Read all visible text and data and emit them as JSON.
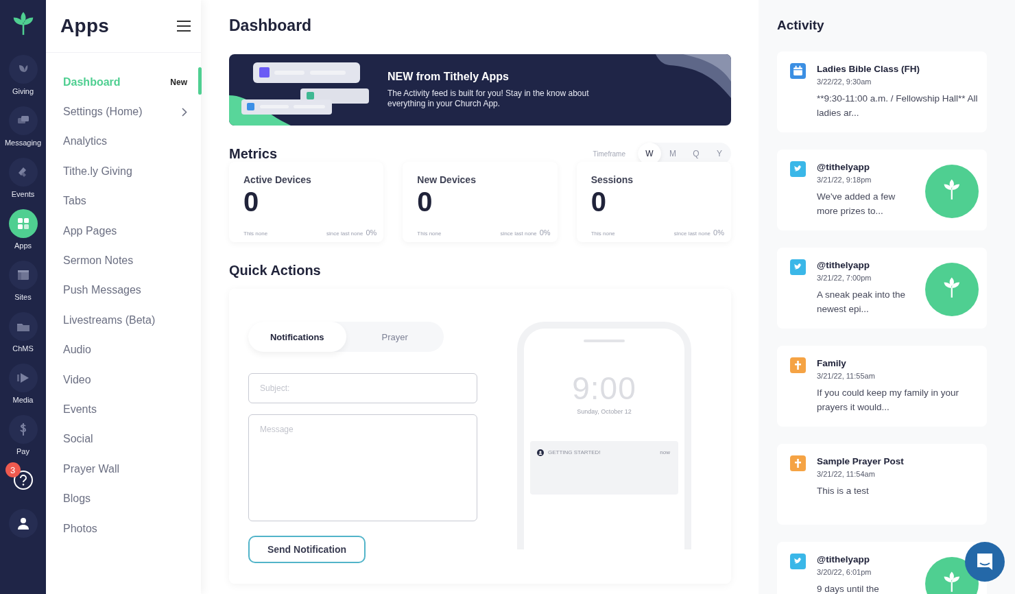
{
  "rail": {
    "items": [
      {
        "label": "Giving",
        "selected": false
      },
      {
        "label": "Messaging",
        "selected": false
      },
      {
        "label": "Events",
        "selected": false
      },
      {
        "label": "Apps",
        "selected": true
      },
      {
        "label": "Sites",
        "selected": false
      },
      {
        "label": "ChMS",
        "selected": false
      },
      {
        "label": "Media",
        "selected": false
      },
      {
        "label": "Pay",
        "selected": false
      }
    ],
    "help_badge": "3"
  },
  "menu": {
    "title": "Apps",
    "items": [
      {
        "label": "Dashboard",
        "selected": true,
        "badge": "New"
      },
      {
        "label": "Settings (Home)",
        "selected": false,
        "expandable": true
      },
      {
        "label": "Analytics",
        "selected": false
      },
      {
        "label": "Tithe.ly Giving",
        "selected": false
      },
      {
        "label": "Tabs",
        "selected": false
      },
      {
        "label": "App Pages",
        "selected": false
      },
      {
        "label": "Sermon Notes",
        "selected": false
      },
      {
        "label": "Push Messages",
        "selected": false
      },
      {
        "label": "Livestreams (Beta)",
        "selected": false
      },
      {
        "label": "Audio",
        "selected": false
      },
      {
        "label": "Video",
        "selected": false
      },
      {
        "label": "Events",
        "selected": false
      },
      {
        "label": "Social",
        "selected": false
      },
      {
        "label": "Prayer Wall",
        "selected": false
      },
      {
        "label": "Blogs",
        "selected": false
      },
      {
        "label": "Photos",
        "selected": false
      }
    ]
  },
  "main": {
    "title": "Dashboard",
    "banner": {
      "title": "NEW from Tithely Apps",
      "text": "The Activity feed is built for you! Stay in the know about everything in your Church App."
    },
    "metrics": {
      "title": "Metrics",
      "timeframe_label": "Timeframe",
      "periods": [
        {
          "label": "W",
          "selected": true
        },
        {
          "label": "M",
          "selected": false
        },
        {
          "label": "Q",
          "selected": false
        },
        {
          "label": "Y",
          "selected": false
        }
      ],
      "cards": [
        {
          "label": "Active Devices",
          "value": "0",
          "this_label": "This none",
          "since_label": "since last none",
          "change": "0%"
        },
        {
          "label": "New Devices",
          "value": "0",
          "this_label": "This none",
          "since_label": "since last none",
          "change": "0%"
        },
        {
          "label": "Sessions",
          "value": "0",
          "this_label": "This none",
          "since_label": "since last none",
          "change": "0%"
        }
      ]
    },
    "quick_actions": {
      "title": "Quick Actions",
      "tabs": [
        {
          "label": "Notifications",
          "selected": true
        },
        {
          "label": "Prayer",
          "selected": false
        }
      ],
      "subject": {
        "placeholder": "Subject:"
      },
      "message": {
        "placeholder": "Message"
      },
      "button": "Send Notification",
      "preview": {
        "time": "9:00",
        "date": "Sunday, October 12",
        "notification_title": "GETTING STARTED!",
        "notification_time": "now"
      }
    }
  },
  "activity": {
    "title": "Activity",
    "items": [
      {
        "kind": "event",
        "color": "#3b8fe3",
        "title": "Ladies Bible Class (FH)",
        "date": "3/22/22, 9:30am",
        "text": "**9:30-11:00 a.m. / Fellowship Hall** All ladies ar...",
        "has_image": false
      },
      {
        "kind": "twitter",
        "color": "#3ab7e8",
        "title": "@tithelyapp",
        "date": "3/21/22, 9:18pm",
        "text": "We've added a few more prizes to...",
        "has_image": true
      },
      {
        "kind": "twitter",
        "color": "#3ab7e8",
        "title": "@tithelyapp",
        "date": "3/21/22, 7:00pm",
        "text": "A sneak peak into the newest epi...",
        "has_image": true
      },
      {
        "kind": "prayer",
        "color": "#f5a344",
        "title": "Family",
        "date": "3/21/22, 11:55am",
        "text": "If you could keep my family in your prayers it would...",
        "has_image": false
      },
      {
        "kind": "prayer",
        "color": "#f5a344",
        "title": "Sample Prayer Post",
        "date": "3/21/22, 11:54am",
        "text": "This is a test",
        "has_image": false
      },
      {
        "kind": "twitter",
        "color": "#3ab7e8",
        "title": "@tithelyapp",
        "date": "3/20/22, 6:01pm",
        "text": "9 days until the",
        "has_image": true
      }
    ]
  }
}
